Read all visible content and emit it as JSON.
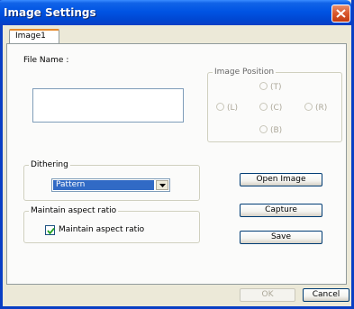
{
  "window": {
    "title": "Image Settings"
  },
  "tabs": [
    {
      "label": "Image1"
    }
  ],
  "file_name": {
    "label": "File Name :",
    "value": ""
  },
  "image_position": {
    "title": "Image Position",
    "options": [
      {
        "label": "(T)"
      },
      {
        "label": "(L)"
      },
      {
        "label": "(C)"
      },
      {
        "label": "(R)"
      },
      {
        "label": "(B)"
      }
    ]
  },
  "dithering": {
    "title": "Dithering",
    "selected": "Pattern"
  },
  "aspect": {
    "title": "Maintain aspect ratio",
    "checkbox_label": "Maintain aspect ratio",
    "checked": true
  },
  "buttons": {
    "open_image": "Open Image",
    "capture": "Capture",
    "save": "Save",
    "ok": "OK",
    "cancel": "Cancel"
  }
}
